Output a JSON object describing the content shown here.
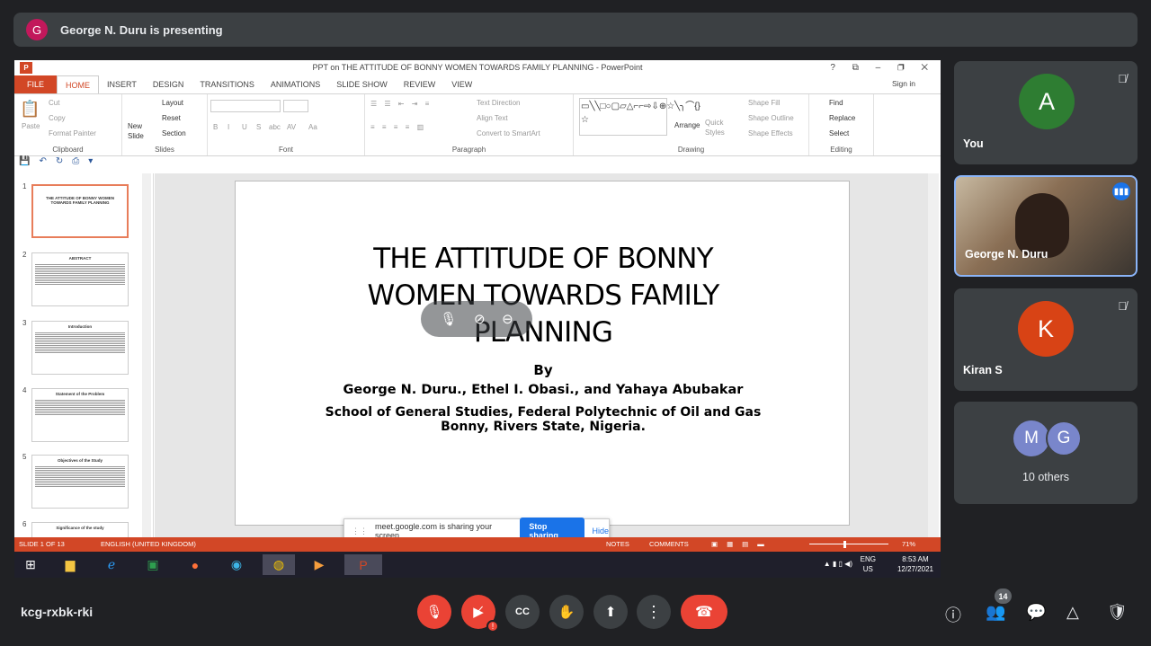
{
  "banner": {
    "avatar_letter": "G",
    "text": "George N. Duru is presenting"
  },
  "ppt": {
    "window_title": "PPT on THE ATTITUDE OF BONNY WOMEN TOWARDS FAMILY PLANNING - PowerPoint",
    "window_controls": "?  ⧉  –  ❐  ✕",
    "tabs": [
      "FILE",
      "HOME",
      "INSERT",
      "DESIGN",
      "TRANSITIONS",
      "ANIMATIONS",
      "SLIDE SHOW",
      "REVIEW",
      "VIEW"
    ],
    "signin": "Sign in",
    "ribbon": {
      "clipboard": {
        "paste": "Paste",
        "cut": "Cut",
        "copy": "Copy",
        "format_painter": "Format Painter",
        "label": "Clipboard"
      },
      "slides": {
        "new_slide": "New Slide",
        "layout": "Layout",
        "reset": "Reset",
        "section": "Section",
        "label": "Slides"
      },
      "font": {
        "label": "Font",
        "bold": "B",
        "italic": "I",
        "underline": "U",
        "strike": "S",
        "abc": "abc",
        "av": "AV",
        "aa": "Aa"
      },
      "paragraph": {
        "text_direction": "Text Direction",
        "align_text": "Align Text",
        "convert": "Convert to SmartArt",
        "label": "Paragraph"
      },
      "drawing": {
        "arrange": "Arrange",
        "quick_styles": "Quick Styles",
        "shape_fill": "Shape Fill",
        "shape_outline": "Shape Outline",
        "shape_effects": "Shape Effects",
        "label": "Drawing"
      },
      "editing": {
        "find": "Find",
        "replace": "Replace",
        "select": "Select",
        "label": "Editing"
      }
    },
    "thumbnails": [
      {
        "num": "1",
        "title": "THE ATTITUDE OF BONNY WOMEN TOWARDS FAMILY PLANNING"
      },
      {
        "num": "2",
        "title": "ABSTRACT"
      },
      {
        "num": "3",
        "title": "Introduction"
      },
      {
        "num": "4",
        "title": "Statement of the Problem"
      },
      {
        "num": "5",
        "title": "Objectives of the Study"
      },
      {
        "num": "6",
        "title": "Significance of the study"
      }
    ],
    "slide": {
      "title_line1": "THE ATTITUDE OF BONNY",
      "title_line2": "WOMEN TOWARDS FAMILY",
      "title_line3": "PLANNING",
      "by": "By",
      "authors": "George N. Duru., Ethel I. Obasi., and Yahaya Abubakar",
      "school_line1": "School of General Studies, Federal Polytechnic of Oil and Gas",
      "school_line2": "Bonny, Rivers State, Nigeria."
    },
    "share_bar": {
      "text": "meet.google.com is sharing your screen.",
      "stop": "Stop sharing",
      "hide": "Hide"
    },
    "status": {
      "slide": "SLIDE 1 OF 13",
      "language": "ENGLISH (UNITED KINGDOM)",
      "notes": "NOTES",
      "comments": "COMMENTS",
      "zoom": "71%",
      "zoom_level": 0.71
    },
    "taskbar": {
      "lang1": "ENG",
      "lang2": "US",
      "time": "8:53 AM",
      "date": "12/27/2021"
    }
  },
  "participants": [
    {
      "name": "You",
      "initial": "A",
      "color": "#2e7d32",
      "muted": true
    },
    {
      "name": "George N. Duru",
      "speaking": true
    },
    {
      "name": "Kiran S",
      "initial": "K",
      "color": "#d84315",
      "muted": true
    },
    {
      "name": "10 others",
      "initials": [
        "M",
        "G"
      ],
      "color": "#7986cb"
    }
  ],
  "bottom": {
    "meeting_code": "kcg-rxbk-rki",
    "people_count": "14"
  },
  "colors": {
    "accent_red": "#ea4335",
    "ppt_orange": "#d24726",
    "meet_bg": "#202124",
    "tile_bg": "#3c4043",
    "blue": "#1a73e8"
  }
}
